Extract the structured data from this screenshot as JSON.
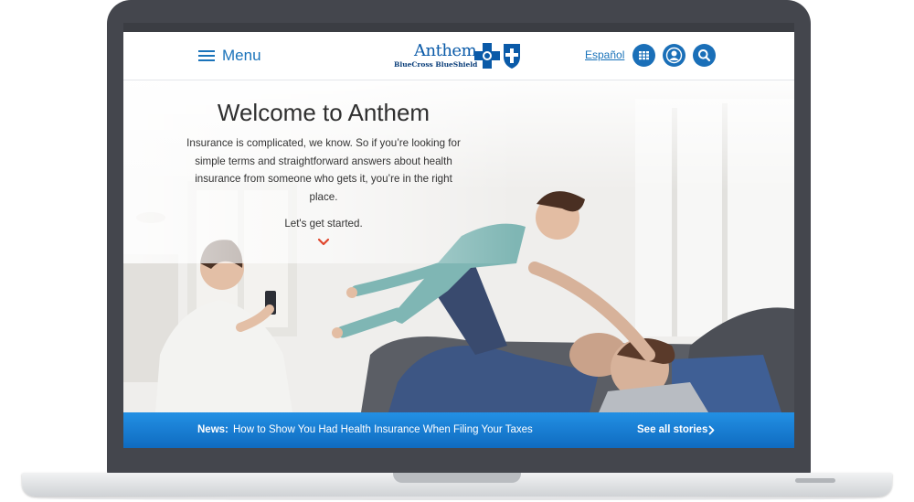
{
  "header": {
    "menu_label": "Menu",
    "logo": {
      "name": "Anthem",
      "tagline": "BlueCross BlueShield"
    },
    "language_link": "Español",
    "icons": [
      "apps-grid-icon",
      "user-profile-icon",
      "search-icon"
    ]
  },
  "hero": {
    "title": "Welcome to Anthem",
    "body": "Insurance is complicated, we know. So if you’re looking for simple terms and straightforward answers about health insurance from someone who gets it, you’re in the right place.",
    "cta": "Let's get started.",
    "cta_icon": "chevron-down-icon",
    "image_alt": "family playing on a couch"
  },
  "news": {
    "label": "News:",
    "headline": "How to Show You Had Health Insurance When Filing Your Taxes",
    "see_all": "See all stories"
  },
  "colors": {
    "brand_blue": "#1a73ba",
    "news_bar": "#1678cf",
    "cta_arrow": "#e0462c"
  }
}
